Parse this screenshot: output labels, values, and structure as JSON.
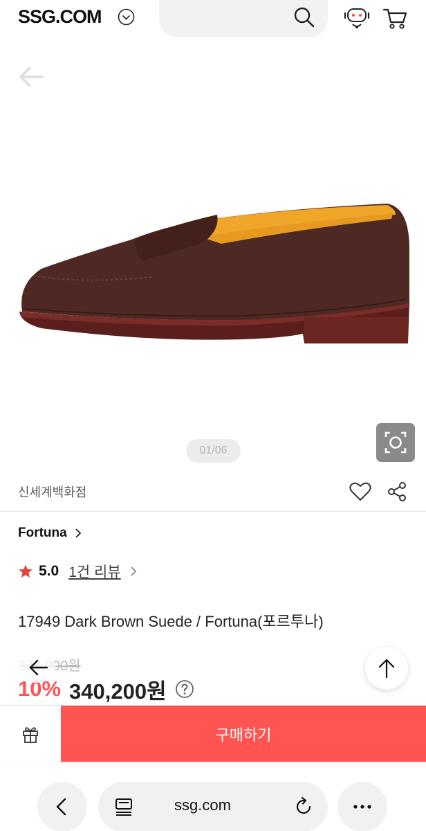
{
  "header": {
    "logo": "SSG.COM"
  },
  "gallery": {
    "counter": "01/06"
  },
  "seller": {
    "name": "신세계백화점"
  },
  "product": {
    "brand": "Fortuna",
    "rating": "5.0",
    "review_link": "1건 리뷰",
    "title": "17949 Dark Brown Suede / Fortuna(포르투나)",
    "original_price": "378,000원",
    "discount_rate": "10%",
    "sale_price": "340,200원"
  },
  "purchase_bar": {
    "buy_label": "구매하기"
  },
  "browser": {
    "url": "ssg.com"
  },
  "colors": {
    "accent": "#ff5452",
    "star": "#e8423f"
  }
}
